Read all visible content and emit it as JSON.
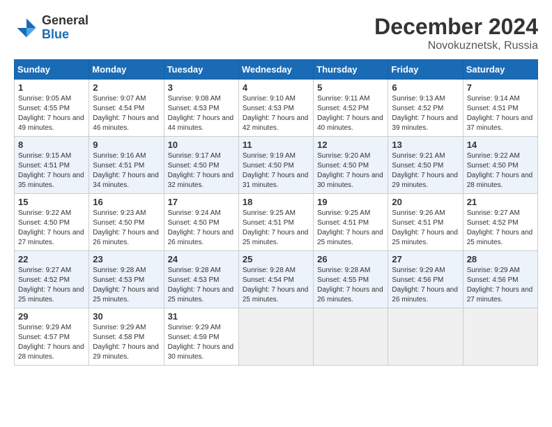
{
  "header": {
    "logo_general": "General",
    "logo_blue": "Blue",
    "month_title": "December 2024",
    "location": "Novokuznetsk, Russia"
  },
  "days_of_week": [
    "Sunday",
    "Monday",
    "Tuesday",
    "Wednesday",
    "Thursday",
    "Friday",
    "Saturday"
  ],
  "weeks": [
    [
      {
        "day": "1",
        "sunrise": "Sunrise: 9:05 AM",
        "sunset": "Sunset: 4:55 PM",
        "daylight": "Daylight: 7 hours and 49 minutes."
      },
      {
        "day": "2",
        "sunrise": "Sunrise: 9:07 AM",
        "sunset": "Sunset: 4:54 PM",
        "daylight": "Daylight: 7 hours and 46 minutes."
      },
      {
        "day": "3",
        "sunrise": "Sunrise: 9:08 AM",
        "sunset": "Sunset: 4:53 PM",
        "daylight": "Daylight: 7 hours and 44 minutes."
      },
      {
        "day": "4",
        "sunrise": "Sunrise: 9:10 AM",
        "sunset": "Sunset: 4:53 PM",
        "daylight": "Daylight: 7 hours and 42 minutes."
      },
      {
        "day": "5",
        "sunrise": "Sunrise: 9:11 AM",
        "sunset": "Sunset: 4:52 PM",
        "daylight": "Daylight: 7 hours and 40 minutes."
      },
      {
        "day": "6",
        "sunrise": "Sunrise: 9:13 AM",
        "sunset": "Sunset: 4:52 PM",
        "daylight": "Daylight: 7 hours and 39 minutes."
      },
      {
        "day": "7",
        "sunrise": "Sunrise: 9:14 AM",
        "sunset": "Sunset: 4:51 PM",
        "daylight": "Daylight: 7 hours and 37 minutes."
      }
    ],
    [
      {
        "day": "8",
        "sunrise": "Sunrise: 9:15 AM",
        "sunset": "Sunset: 4:51 PM",
        "daylight": "Daylight: 7 hours and 35 minutes."
      },
      {
        "day": "9",
        "sunrise": "Sunrise: 9:16 AM",
        "sunset": "Sunset: 4:51 PM",
        "daylight": "Daylight: 7 hours and 34 minutes."
      },
      {
        "day": "10",
        "sunrise": "Sunrise: 9:17 AM",
        "sunset": "Sunset: 4:50 PM",
        "daylight": "Daylight: 7 hours and 32 minutes."
      },
      {
        "day": "11",
        "sunrise": "Sunrise: 9:19 AM",
        "sunset": "Sunset: 4:50 PM",
        "daylight": "Daylight: 7 hours and 31 minutes."
      },
      {
        "day": "12",
        "sunrise": "Sunrise: 9:20 AM",
        "sunset": "Sunset: 4:50 PM",
        "daylight": "Daylight: 7 hours and 30 minutes."
      },
      {
        "day": "13",
        "sunrise": "Sunrise: 9:21 AM",
        "sunset": "Sunset: 4:50 PM",
        "daylight": "Daylight: 7 hours and 29 minutes."
      },
      {
        "day": "14",
        "sunrise": "Sunrise: 9:22 AM",
        "sunset": "Sunset: 4:50 PM",
        "daylight": "Daylight: 7 hours and 28 minutes."
      }
    ],
    [
      {
        "day": "15",
        "sunrise": "Sunrise: 9:22 AM",
        "sunset": "Sunset: 4:50 PM",
        "daylight": "Daylight: 7 hours and 27 minutes."
      },
      {
        "day": "16",
        "sunrise": "Sunrise: 9:23 AM",
        "sunset": "Sunset: 4:50 PM",
        "daylight": "Daylight: 7 hours and 26 minutes."
      },
      {
        "day": "17",
        "sunrise": "Sunrise: 9:24 AM",
        "sunset": "Sunset: 4:50 PM",
        "daylight": "Daylight: 7 hours and 26 minutes."
      },
      {
        "day": "18",
        "sunrise": "Sunrise: 9:25 AM",
        "sunset": "Sunset: 4:51 PM",
        "daylight": "Daylight: 7 hours and 25 minutes."
      },
      {
        "day": "19",
        "sunrise": "Sunrise: 9:25 AM",
        "sunset": "Sunset: 4:51 PM",
        "daylight": "Daylight: 7 hours and 25 minutes."
      },
      {
        "day": "20",
        "sunrise": "Sunrise: 9:26 AM",
        "sunset": "Sunset: 4:51 PM",
        "daylight": "Daylight: 7 hours and 25 minutes."
      },
      {
        "day": "21",
        "sunrise": "Sunrise: 9:27 AM",
        "sunset": "Sunset: 4:52 PM",
        "daylight": "Daylight: 7 hours and 25 minutes."
      }
    ],
    [
      {
        "day": "22",
        "sunrise": "Sunrise: 9:27 AM",
        "sunset": "Sunset: 4:52 PM",
        "daylight": "Daylight: 7 hours and 25 minutes."
      },
      {
        "day": "23",
        "sunrise": "Sunrise: 9:28 AM",
        "sunset": "Sunset: 4:53 PM",
        "daylight": "Daylight: 7 hours and 25 minutes."
      },
      {
        "day": "24",
        "sunrise": "Sunrise: 9:28 AM",
        "sunset": "Sunset: 4:53 PM",
        "daylight": "Daylight: 7 hours and 25 minutes."
      },
      {
        "day": "25",
        "sunrise": "Sunrise: 9:28 AM",
        "sunset": "Sunset: 4:54 PM",
        "daylight": "Daylight: 7 hours and 25 minutes."
      },
      {
        "day": "26",
        "sunrise": "Sunrise: 9:28 AM",
        "sunset": "Sunset: 4:55 PM",
        "daylight": "Daylight: 7 hours and 26 minutes."
      },
      {
        "day": "27",
        "sunrise": "Sunrise: 9:29 AM",
        "sunset": "Sunset: 4:56 PM",
        "daylight": "Daylight: 7 hours and 26 minutes."
      },
      {
        "day": "28",
        "sunrise": "Sunrise: 9:29 AM",
        "sunset": "Sunset: 4:56 PM",
        "daylight": "Daylight: 7 hours and 27 minutes."
      }
    ],
    [
      {
        "day": "29",
        "sunrise": "Sunrise: 9:29 AM",
        "sunset": "Sunset: 4:57 PM",
        "daylight": "Daylight: 7 hours and 28 minutes."
      },
      {
        "day": "30",
        "sunrise": "Sunrise: 9:29 AM",
        "sunset": "Sunset: 4:58 PM",
        "daylight": "Daylight: 7 hours and 29 minutes."
      },
      {
        "day": "31",
        "sunrise": "Sunrise: 9:29 AM",
        "sunset": "Sunset: 4:59 PM",
        "daylight": "Daylight: 7 hours and 30 minutes."
      },
      null,
      null,
      null,
      null
    ]
  ]
}
